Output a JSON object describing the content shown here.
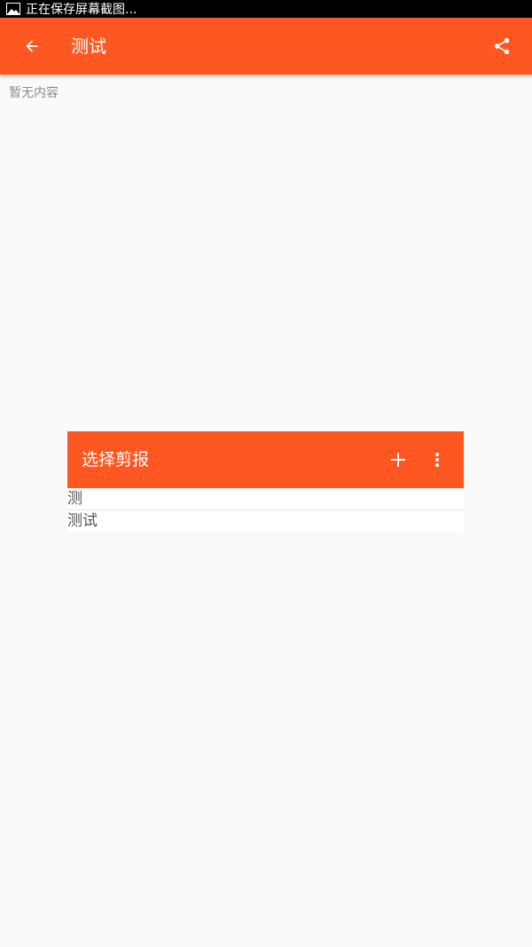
{
  "status_bar": {
    "text": "正在保存屏幕截图..."
  },
  "toolbar": {
    "title": "测试",
    "back_icon": "arrow-back-icon",
    "share_icon": "share-icon"
  },
  "main": {
    "empty_text": "暂无内容"
  },
  "dialog": {
    "title": "选择剪报",
    "add_icon": "plus-icon",
    "more_icon": "more-vert-icon",
    "items": [
      {
        "label": "测"
      },
      {
        "label": "测试"
      }
    ]
  },
  "colors": {
    "accent": "#ff5722",
    "background": "#fafafa",
    "status_bar": "#000000"
  }
}
